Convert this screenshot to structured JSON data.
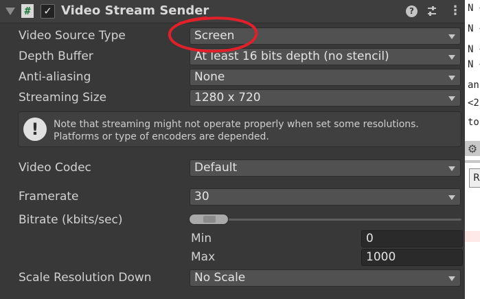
{
  "component": {
    "title": "Video Stream Sender",
    "enabled": true
  },
  "icons": {
    "foldout": "foldout-arrow-icon",
    "script": "csharp-script-icon",
    "help": "help-icon",
    "presets": "sliders-icon",
    "menu": "kebab-menu-icon",
    "warning": "warning-icon"
  },
  "fields": {
    "video_source_type": {
      "label": "Video Source Type",
      "value": "Screen"
    },
    "depth_buffer": {
      "label": "Depth Buffer",
      "value": "At least 16 bits depth (no stencil)"
    },
    "anti_aliasing": {
      "label": "Anti-aliasing",
      "value": "None"
    },
    "streaming_size": {
      "label": "Streaming Size",
      "value": "1280 x 720"
    },
    "video_codec": {
      "label": "Video Codec",
      "value": "Default"
    },
    "framerate": {
      "label": "Framerate",
      "value": "30"
    },
    "bitrate": {
      "label": "Bitrate (kbits/sec)",
      "min_label": "Min",
      "min_value": "0",
      "max_label": "Max",
      "max_value": "1000"
    },
    "scale_resolution_down": {
      "label": "Scale Resolution Down",
      "value": "No Scale"
    }
  },
  "help_message": {
    "line1": "Note that streaming might not operate properly when set some resolutions.",
    "line2": "Platforms or type of encoders are depended."
  },
  "side_panel": {
    "lines": [
      "N <",
      "N <",
      "N <",
      "N <",
      "anc",
      "<2",
      "to"
    ],
    "button": "R"
  },
  "colors": {
    "annotation": "#e2202a",
    "background": "#383838",
    "field": "#515151"
  }
}
